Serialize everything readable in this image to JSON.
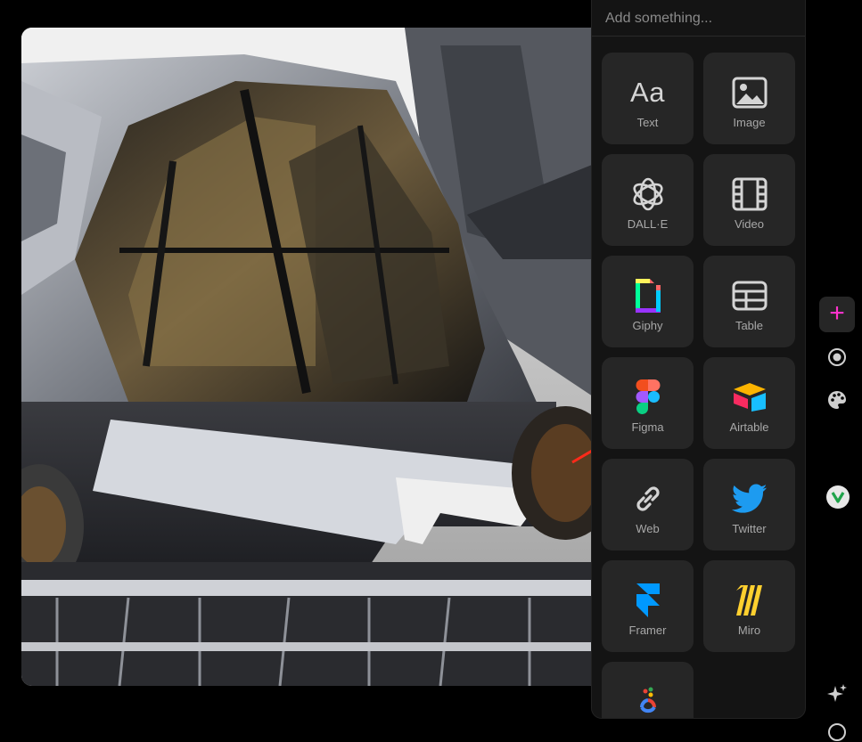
{
  "search": {
    "placeholder": "Add something..."
  },
  "tiles": [
    {
      "label": "Text",
      "icon": "text-aa-icon",
      "glyph": "Aa"
    },
    {
      "label": "Image",
      "icon": "image-icon"
    },
    {
      "label": "DALL·E",
      "icon": "openai-icon"
    },
    {
      "label": "Video",
      "icon": "film-icon"
    },
    {
      "label": "Giphy",
      "icon": "giphy-icon"
    },
    {
      "label": "Table",
      "icon": "table-icon"
    },
    {
      "label": "Figma",
      "icon": "figma-icon"
    },
    {
      "label": "Airtable",
      "icon": "airtable-icon"
    },
    {
      "label": "Web",
      "icon": "link-icon"
    },
    {
      "label": "Twitter",
      "icon": "twitter-icon"
    },
    {
      "label": "Framer",
      "icon": "framer-icon"
    },
    {
      "label": "Miro",
      "icon": "miro-icon"
    },
    {
      "label": "",
      "icon": "google-lens-icon"
    }
  ],
  "rail": {
    "add": "+",
    "accent": "#ff33cc"
  },
  "colors": {
    "panel_bg": "#141414",
    "tile_bg": "#262626",
    "tile_label": "#a8a8a8",
    "annotation_arrow": "#ff2a1a"
  }
}
